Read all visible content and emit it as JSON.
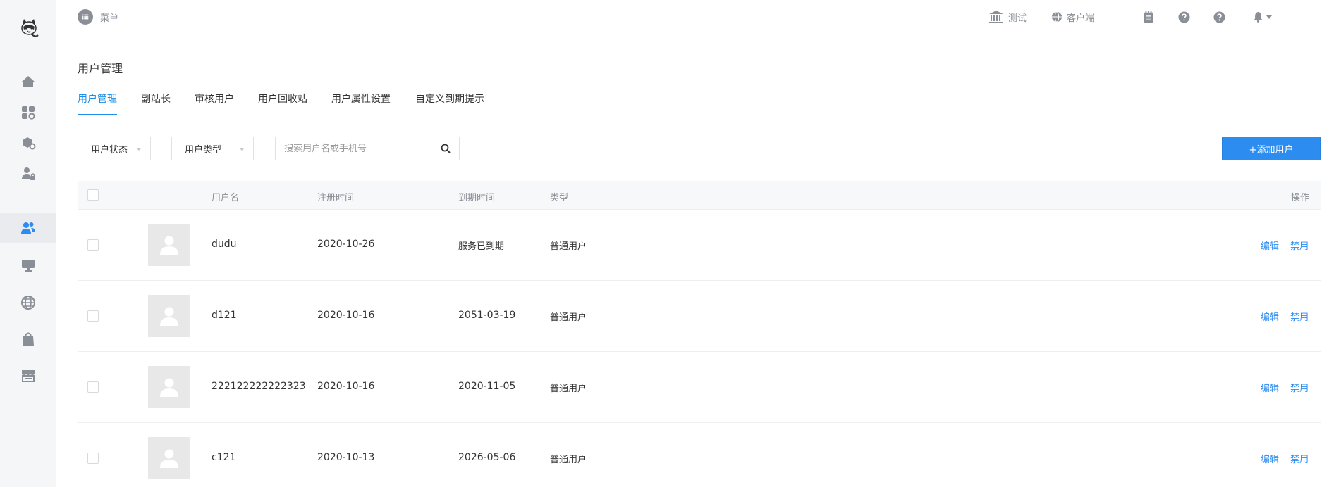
{
  "header": {
    "menu_label": "菜单",
    "link_test": "测试",
    "link_client": "客户端"
  },
  "sidebar": {
    "items": [
      {
        "icon": "home-icon"
      },
      {
        "icon": "apps-settings-icon"
      },
      {
        "icon": "package-settings-icon"
      },
      {
        "icon": "user-lock-icon"
      },
      {
        "icon": "users-icon",
        "active": true
      },
      {
        "icon": "monitor-icon"
      },
      {
        "icon": "globe-icon"
      },
      {
        "icon": "shopping-bag-icon"
      },
      {
        "icon": "store-icon"
      }
    ]
  },
  "main": {
    "page_title": "用户管理",
    "tabs": [
      {
        "label": "用户管理",
        "active": true
      },
      {
        "label": "副站长"
      },
      {
        "label": "审核用户"
      },
      {
        "label": "用户回收站"
      },
      {
        "label": "用户属性设置"
      },
      {
        "label": "自定义到期提示"
      }
    ],
    "filters": {
      "status_label": "用户状态",
      "type_label": "用户类型",
      "search_placeholder": "搜索用户名或手机号"
    },
    "add_user_label": "+添加用户"
  },
  "table": {
    "columns": {
      "username": "用户名",
      "register_time": "注册时间",
      "expire_time": "到期时间",
      "type": "类型",
      "actions": "操作"
    },
    "rows": [
      {
        "username": "dudu",
        "register_time": "2020-10-26",
        "expire_time": "服务已到期",
        "type": "普通用户",
        "edit": "编辑",
        "disable": "禁用"
      },
      {
        "username": "d121",
        "register_time": "2020-10-16",
        "expire_time": "2051-03-19",
        "type": "普通用户",
        "edit": "编辑",
        "disable": "禁用"
      },
      {
        "username": "222122222222323",
        "register_time": "2020-10-16",
        "expire_time": "2020-11-05",
        "type": "普通用户",
        "edit": "编辑",
        "disable": "禁用"
      },
      {
        "username": "c121",
        "register_time": "2020-10-13",
        "expire_time": "2026-05-06",
        "type": "普通用户",
        "edit": "编辑",
        "disable": "禁用"
      }
    ]
  },
  "colors": {
    "accent": "#2d8cf0",
    "tab_active": "#1d8fe8",
    "sidebar_bg": "#f5f6f7",
    "icon_gray": "#8a8f97"
  }
}
